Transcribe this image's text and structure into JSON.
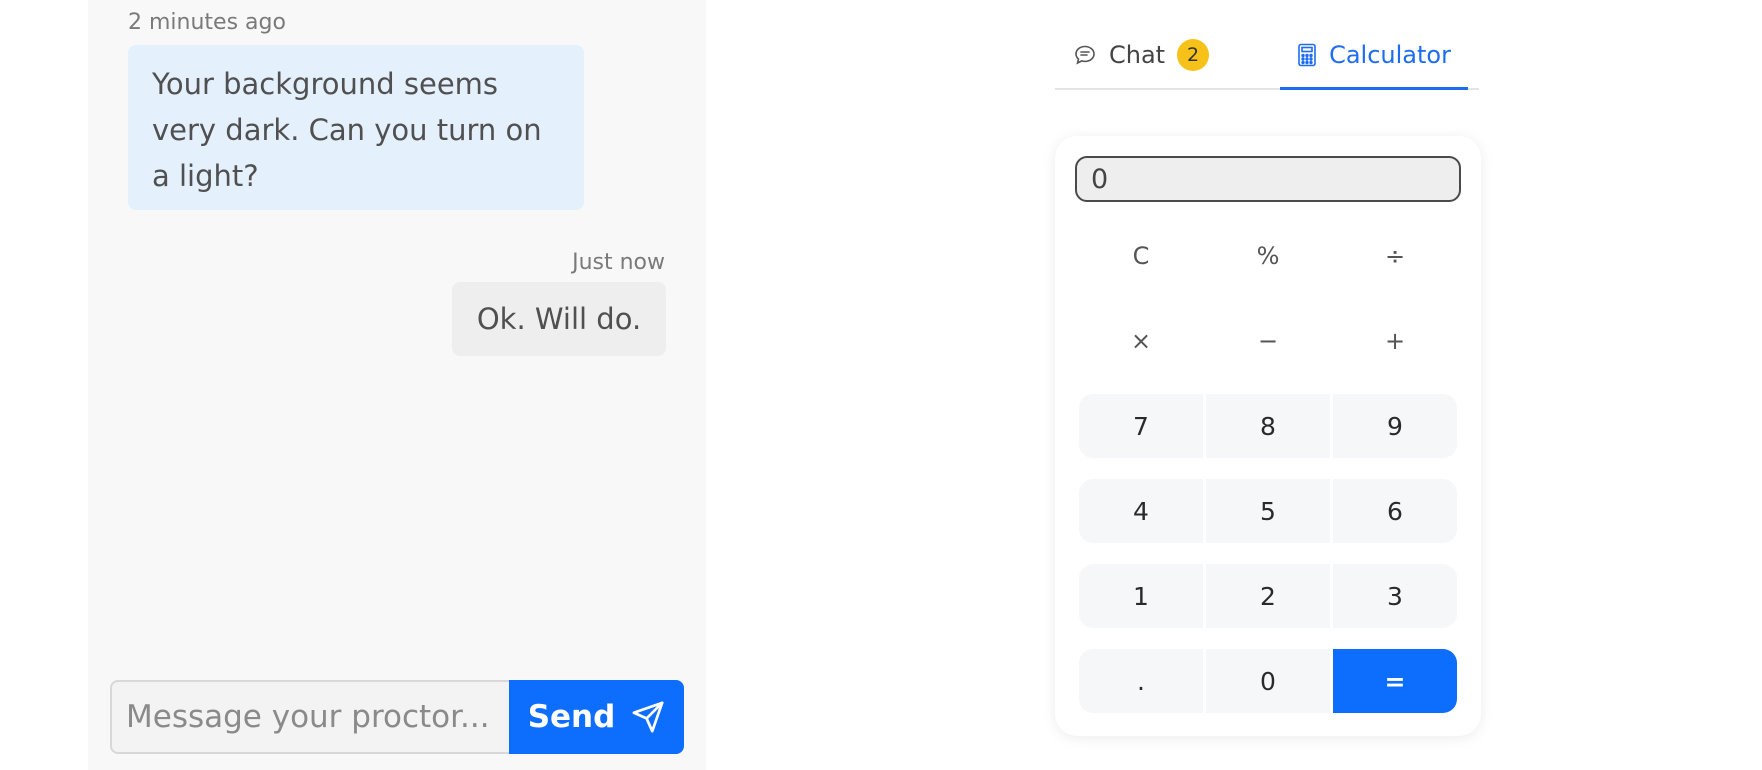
{
  "chat": {
    "messages": [
      {
        "timestamp": "2 minutes ago",
        "text": "Your background seems very dark. Can you turn on a light?",
        "direction": "incoming"
      },
      {
        "timestamp": "Just now",
        "text": "Ok. Will do.",
        "direction": "outgoing"
      }
    ],
    "input_placeholder": "Message your proctor...",
    "send_label": "Send",
    "send_icon": "paper-plane-icon"
  },
  "tabs": [
    {
      "label": "Chat",
      "icon": "chat-bubble-icon",
      "badge": "2",
      "active": false
    },
    {
      "label": "Calculator",
      "icon": "calculator-icon",
      "active": true
    }
  ],
  "calculator": {
    "display": "0",
    "keys": {
      "clear": "C",
      "percent": "%",
      "divide": "÷",
      "multiply": "×",
      "minus": "−",
      "plus": "+",
      "seven": "7",
      "eight": "8",
      "nine": "9",
      "four": "4",
      "five": "5",
      "six": "6",
      "one": "1",
      "two": "2",
      "three": "3",
      "decimal": ".",
      "zero": "0",
      "equals": "="
    }
  },
  "colors": {
    "accent": "#0d6efd",
    "badge": "#f6c21a",
    "incoming_bubble": "#e5f0fd",
    "outgoing_bubble": "#eeeeee"
  }
}
